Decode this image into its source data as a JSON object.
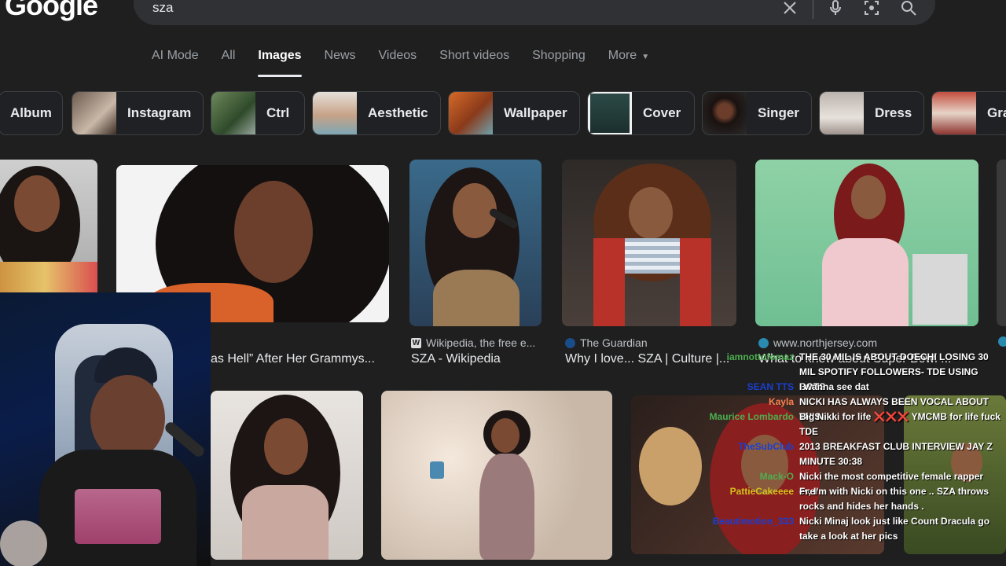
{
  "logo": "Google",
  "search": {
    "query": "sza"
  },
  "tabs": [
    {
      "label": "AI Mode",
      "active": false
    },
    {
      "label": "All",
      "active": false
    },
    {
      "label": "Images",
      "active": true
    },
    {
      "label": "News",
      "active": false
    },
    {
      "label": "Videos",
      "active": false
    },
    {
      "label": "Short videos",
      "active": false
    },
    {
      "label": "Shopping",
      "active": false
    },
    {
      "label": "More",
      "active": false
    }
  ],
  "chips": [
    "Album",
    "Instagram",
    "Ctrl",
    "Aesthetic",
    "Wallpaper",
    "Cover",
    "Singer",
    "Dress",
    "Gra"
  ],
  "results": [
    {
      "source": "",
      "title": "as Hell” After Her Grammys..."
    },
    {
      "source": "Wikipedia, the free e...",
      "title": "SZA - Wikipedia"
    },
    {
      "source": "The Guardian",
      "title": "Why I love... SZA | Culture |..."
    },
    {
      "source": "www.northjersey.com",
      "title": "What to know about Super Bowl ..."
    }
  ],
  "chat": [
    {
      "user": "iamnottofomaz",
      "color": "#4caf50",
      "msg": "THE 30 MIL IS ABOUT DOECHI LOSING 30 MIL SPOTIFY FOLLOWERS- TDE USING BOTS"
    },
    {
      "user": "SEAN TTS",
      "color": "#1a3fd1",
      "msg": "I wanna see dat"
    },
    {
      "user": "Kayla",
      "color": "#ff7f50",
      "msg": "NICKI HAS ALWAYS BEEN VOCAL ABOUT THIS"
    },
    {
      "user": "Maurice Lombardo",
      "color": "#4caf50",
      "msg": "Big Nikki for life ❌❌❌ YMCMB for life fuck TDE"
    },
    {
      "user": "TheSubClub",
      "color": "#1a3fd1",
      "msg": "2013 BREAKFAST CLUB INTERVIEW JAY Z MINUTE 30:38"
    },
    {
      "user": "Mack-O",
      "color": "#4caf50",
      "msg": "Nicki the most competitive female rapper ever"
    },
    {
      "user": "PattieCakeeee",
      "color": "#d4c21a",
      "msg": "Fr, I'm with Nicki on this one .. SZA throws rocks and hides her hands ."
    },
    {
      "user": "Beautimotion_333",
      "color": "#1a3fd1",
      "msg": "Nicki Minaj look just like Count Dracula go take a look at her pics"
    }
  ],
  "colors": {
    "background": "#1f1f1f",
    "searchbar": "#303134",
    "text": "#e8eaed",
    "muted": "#9aa0a6"
  }
}
